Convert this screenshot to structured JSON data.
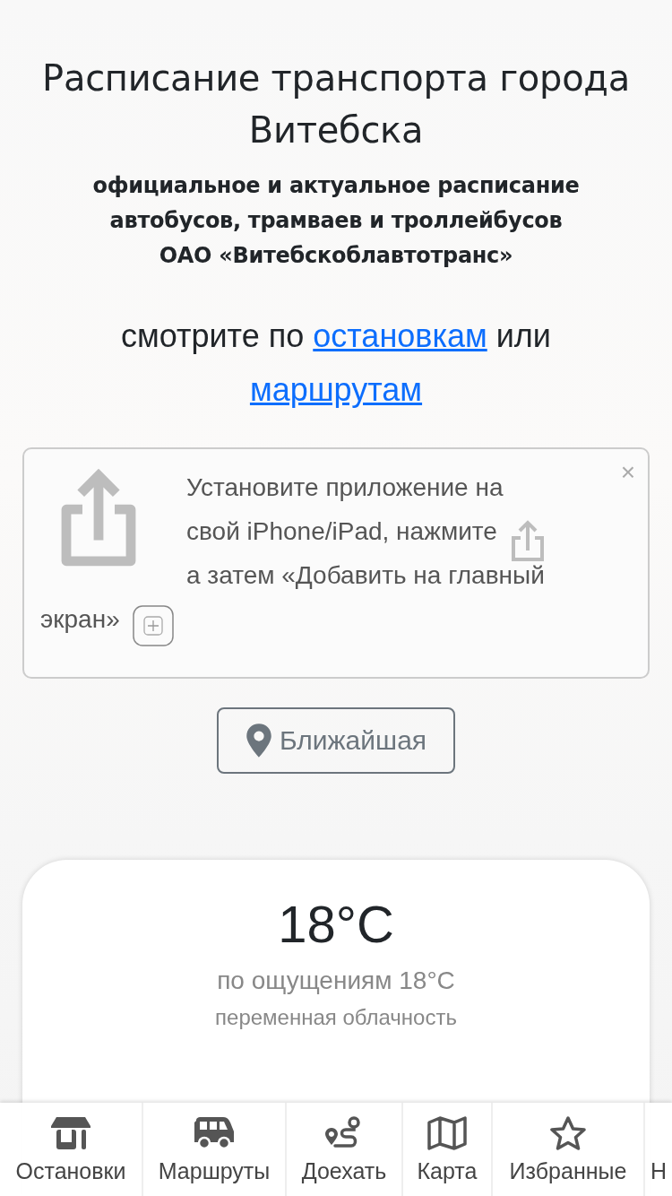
{
  "header": {
    "title": "Расписание транспорта города Витебска",
    "subtitle_lines": [
      "официальное и актуальное расписание",
      "автобусов, трамваев и троллейбусов",
      "ОАО «Витебскоблавтотранс»"
    ]
  },
  "browse": {
    "prefix": "смотрите по",
    "link_stops": "остановкам",
    "middle": "или",
    "link_routes": "маршрутам"
  },
  "install_banner": {
    "lines": [
      {
        "kind": "plain",
        "text": "Установите приложение на"
      },
      {
        "kind": "share",
        "text": "свой iPhone/iPad, нажмите"
      },
      {
        "kind": "plain",
        "text": "а затем «Добавить на главный"
      },
      {
        "kind": "add",
        "text": "экран»"
      }
    ],
    "close": "×"
  },
  "nearest_button": {
    "label": "Ближайшая"
  },
  "weather": {
    "temperature": "18°C",
    "feels_like": "по ощущениям 18°C",
    "condition": "переменная облачность"
  },
  "bottom_nav": [
    {
      "kind": "stops",
      "label": "Остановки"
    },
    {
      "kind": "routes",
      "label": "Маршруты"
    },
    {
      "kind": "directions",
      "label": "Доехать"
    },
    {
      "kind": "map",
      "label": "Карта"
    },
    {
      "kind": "favorites",
      "label": "Избранные"
    },
    {
      "kind": "more",
      "label": "Н"
    }
  ]
}
